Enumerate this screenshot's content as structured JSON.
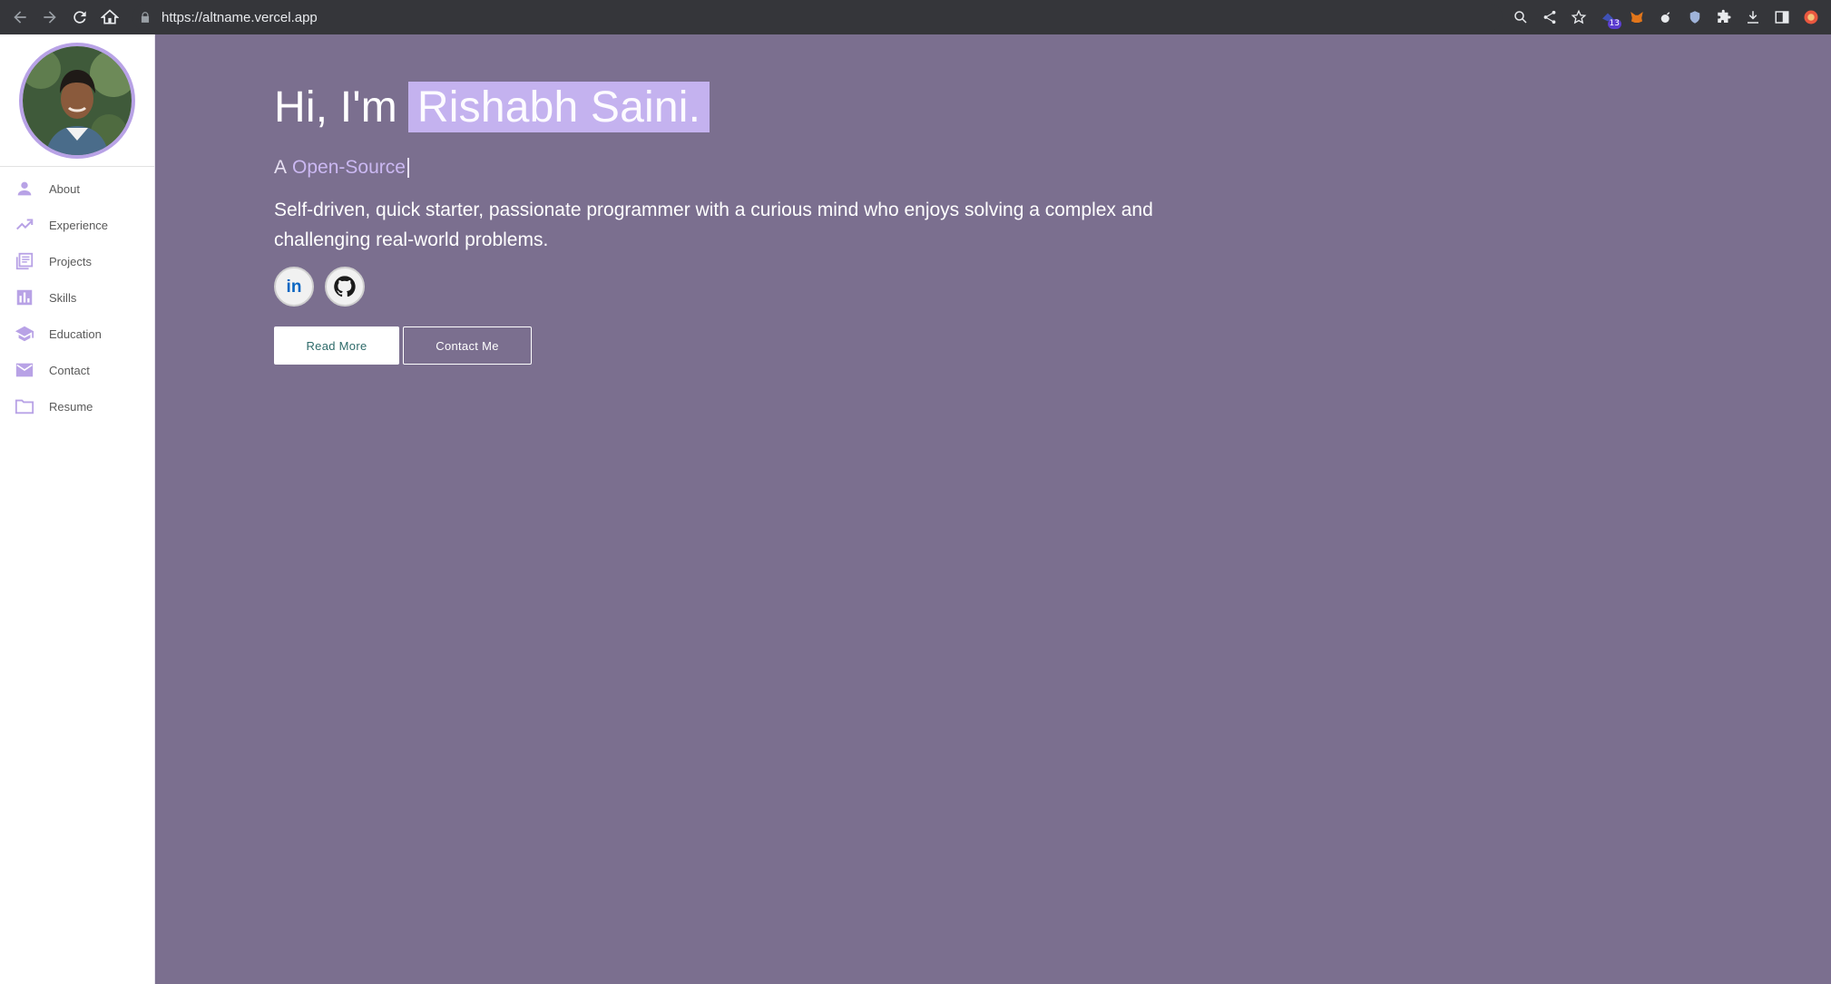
{
  "browser": {
    "url": "https://altname.vercel.app",
    "extension_badge": "13"
  },
  "sidebar": {
    "items": [
      {
        "label": "About",
        "icon": "person-icon"
      },
      {
        "label": "Experience",
        "icon": "trending-up-icon"
      },
      {
        "label": "Projects",
        "icon": "library-books-icon"
      },
      {
        "label": "Skills",
        "icon": "bar-chart-icon"
      },
      {
        "label": "Education",
        "icon": "school-icon"
      },
      {
        "label": "Contact",
        "icon": "mail-icon"
      },
      {
        "label": "Resume",
        "icon": "folder-icon"
      }
    ]
  },
  "hero": {
    "greeting": "Hi, I'm",
    "name": "Rishabh Saini.",
    "role_prefix": "A",
    "role": "Open-Source",
    "description": "Self-driven, quick starter, passionate programmer with a curious mind who enjoys solving a complex and challenging real-world problems.",
    "read_more_label": "Read More",
    "contact_label": "Contact Me"
  },
  "colors": {
    "background": "#7b6f8f",
    "accent": "#b8a2e6",
    "name_highlight": "#c4b2ef",
    "button_text": "#2e6b6a"
  }
}
